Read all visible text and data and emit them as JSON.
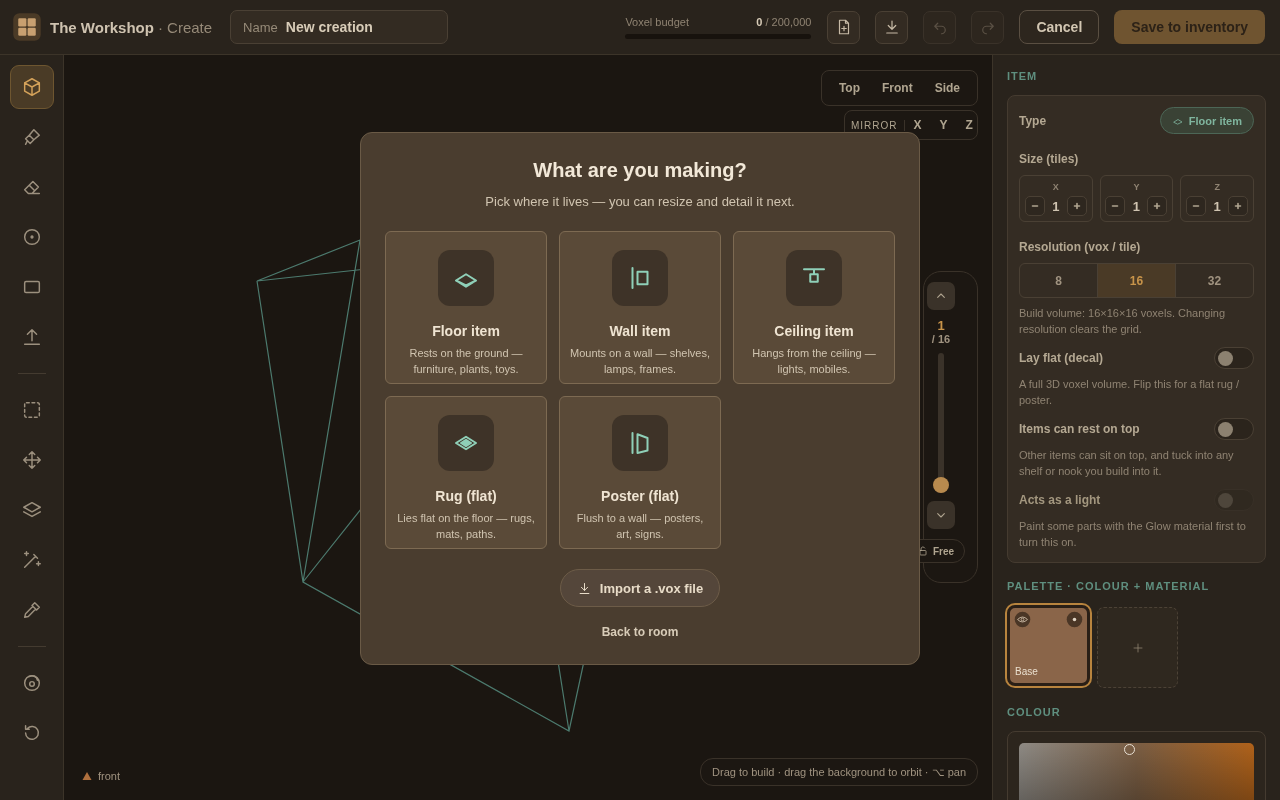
{
  "app": {
    "title": "The Workshop",
    "subtitle": "· Create"
  },
  "name_field": {
    "label": "Name",
    "value": "New creation"
  },
  "budget": {
    "label": "Voxel budget",
    "used": "0",
    "total": "/ 200,000",
    "level": 0
  },
  "toolbar": [
    {
      "kind": "new",
      "disabled": false
    },
    {
      "kind": "download",
      "disabled": false
    },
    {
      "kind": "undo",
      "disabled": true
    },
    {
      "kind": "redo",
      "disabled": true
    }
  ],
  "cancel_button": "Cancel",
  "save_button": "Save to inventory",
  "tool_groups": [
    {
      "tools": [
        {
          "kind": "cube",
          "selected": true
        },
        {
          "kind": "brush",
          "selected": false
        },
        {
          "kind": "eraser",
          "selected": false
        },
        {
          "kind": "point",
          "selected": false
        },
        {
          "kind": "rect",
          "selected": false
        },
        {
          "kind": "extrude",
          "selected": false
        }
      ]
    },
    {
      "tools": [
        {
          "kind": "select",
          "selected": false
        },
        {
          "kind": "move",
          "selected": false
        },
        {
          "kind": "layers",
          "selected": false
        },
        {
          "kind": "wand",
          "selected": false
        },
        {
          "kind": "picker",
          "selected": false
        }
      ]
    },
    {
      "tools": [
        {
          "kind": "orbit",
          "selected": false
        },
        {
          "kind": "reset",
          "selected": false
        }
      ]
    }
  ],
  "views": [
    {
      "label": "Top",
      "selected": false
    },
    {
      "label": "Front",
      "selected": false
    },
    {
      "label": "Side",
      "selected": false
    }
  ],
  "mirror": {
    "label": "MIRROR",
    "axes": [
      {
        "label": "X",
        "selected": false
      },
      {
        "label": "Y",
        "selected": false
      },
      {
        "label": "Z",
        "selected": false
      }
    ]
  },
  "layer": {
    "current": "1",
    "total": "/ 16",
    "level": 0,
    "lock_label": "Free",
    "locked": false
  },
  "axis_label": "front",
  "hint": "Drag to build · drag the background to orbit · ⌥ pan",
  "modal": {
    "title": "What are you making?",
    "subtitle": "Pick where it lives — you can resize and detail it next.",
    "options": [
      {
        "kind": "floor",
        "title": "Floor item",
        "description": "Rests on the ground — furniture, plants, toys."
      },
      {
        "kind": "wall",
        "title": "Wall item",
        "description": "Mounts on a wall — shelves, lamps, frames."
      },
      {
        "kind": "ceiling",
        "title": "Ceiling item",
        "description": "Hangs from the ceiling — lights, mobiles."
      },
      {
        "kind": "rug",
        "title": "Rug (flat)",
        "description": "Lies flat on the floor — rugs, mats, paths."
      },
      {
        "kind": "poster",
        "title": "Poster (flat)",
        "description": "Flush to a wall — posters, art, signs."
      }
    ],
    "import_button": "Import a .vox file",
    "back_link": "Back to room"
  },
  "panel": {
    "item_heading": "ITEM",
    "type_label": "Type",
    "type_value": "Floor item",
    "size_label": "Size (tiles)",
    "sizes": [
      {
        "axis": "X",
        "value": "1"
      },
      {
        "axis": "Y",
        "value": "1"
      },
      {
        "axis": "Z",
        "value": "1"
      }
    ],
    "resolution_label": "Resolution (vox / tile)",
    "resolutions": [
      {
        "label": "8",
        "selected": false
      },
      {
        "label": "16",
        "selected": true
      },
      {
        "label": "32",
        "selected": false
      }
    ],
    "resolution_note": "Build volume: 16×16×16 voxels. Changing resolution clears the grid.",
    "toggles": [
      {
        "label": "Lay flat (decal)",
        "on": false,
        "disabled": false,
        "note": "A full 3D voxel volume. Flip this for a flat rug / poster."
      },
      {
        "label": "Items can rest on top",
        "on": false,
        "disabled": false,
        "note": "Other items can sit on top, and tuck into any shelf or nook you build into it."
      },
      {
        "label": "Acts as a light",
        "on": false,
        "disabled": true,
        "note": "Paint some parts with the Glow material first to turn this on."
      }
    ],
    "palette_heading": "PALETTE · COLOUR + MATERIAL",
    "swatches": [
      {
        "label": "Base",
        "color": "#8a6549",
        "selected": true
      }
    ],
    "colour_heading": "COLOUR"
  }
}
